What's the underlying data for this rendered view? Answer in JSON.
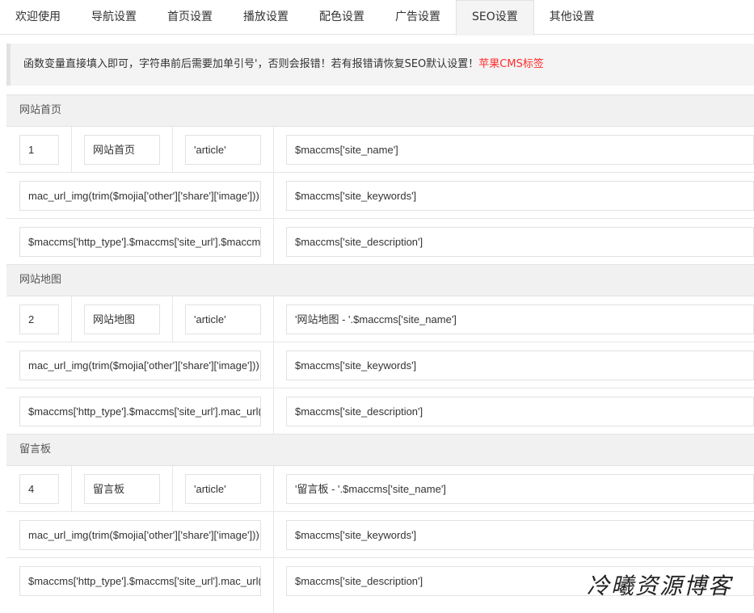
{
  "tabs": [
    {
      "label": "欢迎使用",
      "active": false
    },
    {
      "label": "导航设置",
      "active": false
    },
    {
      "label": "首页设置",
      "active": false
    },
    {
      "label": "播放设置",
      "active": false
    },
    {
      "label": "配色设置",
      "active": false
    },
    {
      "label": "广告设置",
      "active": false
    },
    {
      "label": "SEO设置",
      "active": true
    },
    {
      "label": "其他设置",
      "active": false
    }
  ],
  "notice": {
    "text": "函数变量直接填入即可，字符串前后需要加单引号'，否则会报错！若有报错请恢复SEO默认设置！",
    "link": "苹果CMS标签"
  },
  "sections": [
    {
      "title": "网站首页",
      "id": "1",
      "name": "网站首页",
      "type": "'article'",
      "title_value": "$maccms['site_name']",
      "image_value": "mac_url_img(trim($mojia['other']['share']['image']))",
      "keywords_value": "$maccms['site_keywords']",
      "url_value": "$maccms['http_type'].$maccms['site_url'].$maccms['path']",
      "description_value": "$maccms['site_description']"
    },
    {
      "title": "网站地图",
      "id": "2",
      "name": "网站地图",
      "type": "'article'",
      "title_value": "'网站地图 - '.$maccms['site_name']",
      "image_value": "mac_url_img(trim($mojia['other']['share']['image']))",
      "keywords_value": "$maccms['site_keywords']",
      "url_value": "$maccms['http_type'].$maccms['site_url'].mac_url('map/index')",
      "description_value": "$maccms['site_description']"
    },
    {
      "title": "留言板",
      "id": "4",
      "name": "留言板",
      "type": "'article'",
      "title_value": "'留言板 - '.$maccms['site_name']",
      "image_value": "mac_url_img(trim($mojia['other']['share']['image']))",
      "keywords_value": "$maccms['site_keywords']",
      "url_value": "$maccms['http_type'].$maccms['site_url'].mac_url('gbook/index')",
      "description_value": "$maccms['site_description']"
    }
  ],
  "watermark": "冷曦资源博客"
}
